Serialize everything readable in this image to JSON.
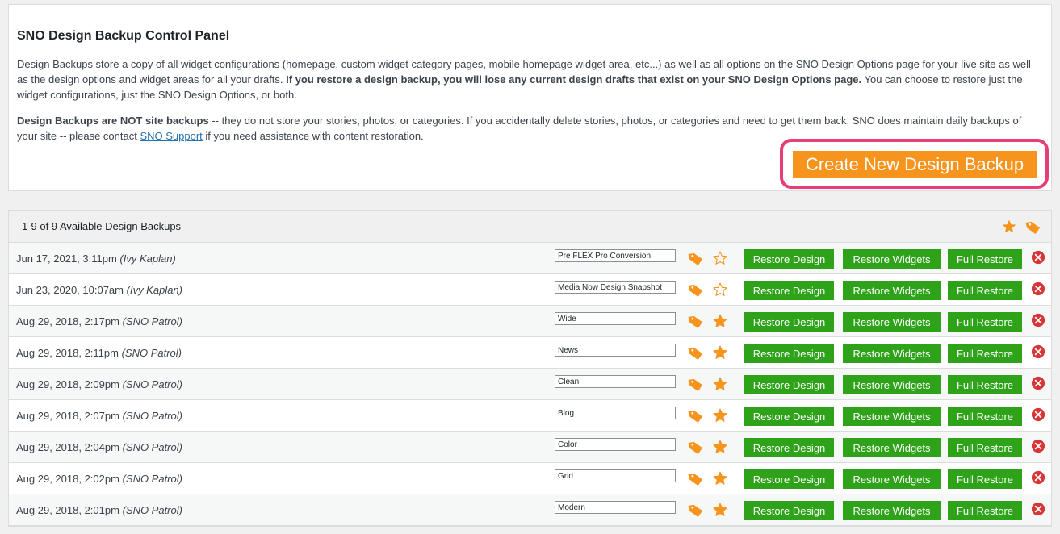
{
  "panel": {
    "title": "SNO Design Backup Control Panel",
    "p1_a": "Design Backups store a copy of all widget configurations (homepage, custom widget category pages, mobile homepage widget area, etc...) as well as all options on the SNO Design Options page for your live site as well as the design options and widget areas for all your drafts. ",
    "p1_bold": "If you restore a design backup, you will lose any current design drafts that exist on your SNO Design Options page.",
    "p1_c": " You can choose to restore just the widget configurations, just the SNO Design Options, or both.",
    "p2_bold": "Design Backups are NOT site backups",
    "p2_a": " -- they do not store your stories, photos, or categories. If you accidentally delete stories, photos, or categories and need to get them back, SNO does maintain daily backups of your site -- please contact ",
    "p2_link": "SNO Support",
    "p2_c": " if you need assistance with content restoration.",
    "create_label": "Create New Design Backup"
  },
  "list": {
    "count_label": "1-9 of 9 Available Design Backups",
    "restore_design_label": "Restore Design",
    "restore_widgets_label": "Restore Widgets",
    "full_restore_label": "Full Restore",
    "rows": [
      {
        "date": "Jun 17, 2021, 3:11pm",
        "author": "(Ivy Kaplan)",
        "name": "Pre FLEX Pro Conversion",
        "starred": false
      },
      {
        "date": "Jun 23, 2020, 10:07am",
        "author": "(Ivy Kaplan)",
        "name": "Media Now Design Snapshot",
        "starred": false
      },
      {
        "date": "Aug 29, 2018, 2:17pm",
        "author": "(SNO Patrol)",
        "name": "Wide",
        "starred": true
      },
      {
        "date": "Aug 29, 2018, 2:11pm",
        "author": "(SNO Patrol)",
        "name": "News",
        "starred": true
      },
      {
        "date": "Aug 29, 2018, 2:09pm",
        "author": "(SNO Patrol)",
        "name": "Clean",
        "starred": true
      },
      {
        "date": "Aug 29, 2018, 2:07pm",
        "author": "(SNO Patrol)",
        "name": "Blog",
        "starred": true
      },
      {
        "date": "Aug 29, 2018, 2:04pm",
        "author": "(SNO Patrol)",
        "name": "Color",
        "starred": true
      },
      {
        "date": "Aug 29, 2018, 2:02pm",
        "author": "(SNO Patrol)",
        "name": "Grid",
        "starred": true
      },
      {
        "date": "Aug 29, 2018, 2:01pm",
        "author": "(SNO Patrol)",
        "name": "Modern",
        "starred": true
      }
    ]
  },
  "colors": {
    "accent_orange": "#f7941d",
    "button_green": "#2ea31a",
    "delete_red": "#d63638",
    "highlight_pink": "#e83e77"
  },
  "icons": {
    "tag": "tag-icon",
    "star_filled": "star-filled-icon",
    "star_outline": "star-outline-icon",
    "delete": "delete-circle-icon"
  }
}
